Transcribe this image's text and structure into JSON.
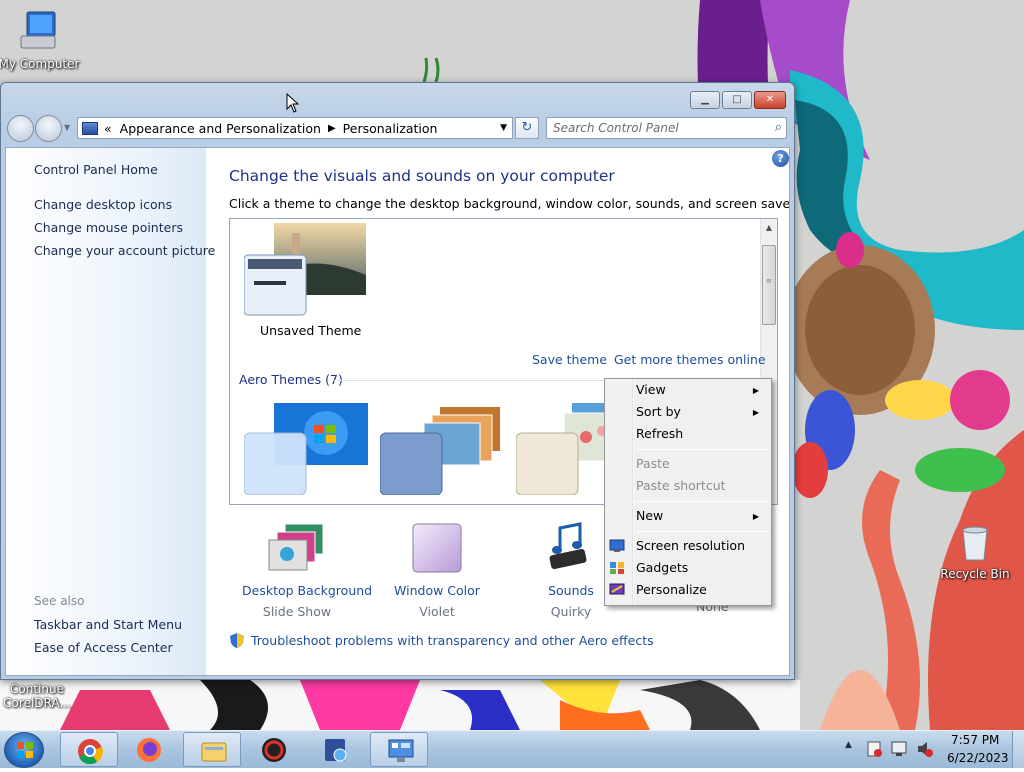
{
  "desktop": {
    "icons": {
      "my_computer": "My Computer",
      "recycle_bin": "Recycle Bin",
      "corel_line1": "Continue",
      "corel_line2": "CorelDRA..."
    }
  },
  "window": {
    "address": {
      "chevrons": "«",
      "crumb1": "Appearance and Personalization",
      "separator": "▶",
      "crumb2": "Personalization"
    },
    "search_placeholder": "Search Control Panel",
    "left_pane": {
      "home": "Control Panel Home",
      "links": [
        "Change desktop icons",
        "Change mouse pointers",
        "Change your account picture"
      ],
      "see_also_label": "See also",
      "see_also": [
        "Taskbar and Start Menu",
        "Ease of Access Center"
      ]
    },
    "title": "Change the visuals and sounds on your computer",
    "subtitle": "Click a theme to change the desktop background, window color, sounds, and screen saver all at once.",
    "my_themes": {
      "unsaved_label": "Unsaved Theme",
      "save_theme": "Save theme",
      "get_more": "Get more themes online"
    },
    "aero_header": "Aero Themes (7)",
    "bottom": {
      "background_link": "Desktop Background",
      "background_value": "Slide Show",
      "color_link": "Window Color",
      "color_value": "Violet",
      "sounds_link": "Sounds",
      "sounds_value": "Quirky",
      "saver_value": "None"
    },
    "troubleshoot": "Troubleshoot problems with transparency and other Aero effects"
  },
  "context_menu": {
    "items": [
      "View",
      "Sort by",
      "Refresh",
      "Paste",
      "Paste shortcut",
      "New",
      "Screen resolution",
      "Gadgets",
      "Personalize"
    ]
  },
  "taskbar": {
    "time": "7:57 PM",
    "date": "6/22/2023"
  },
  "colors": {
    "link": "#1d4f9c",
    "heading": "#1e3287",
    "taskbar": "#a9c4df"
  }
}
